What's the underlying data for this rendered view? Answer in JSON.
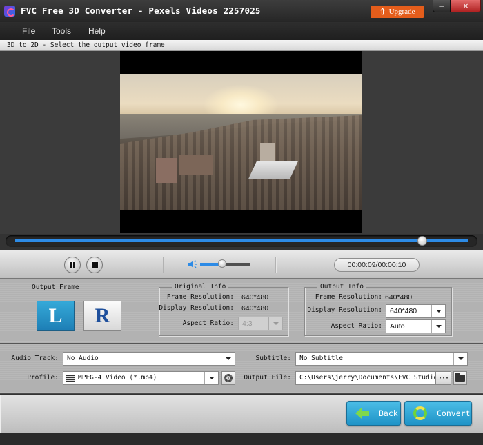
{
  "window": {
    "title": "FVC Free 3D Converter - Pexels Videos 2257025",
    "upgrade_label": "Upgrade",
    "minimize_glyph": "—",
    "close_glyph": "✕"
  },
  "menu": {
    "items": [
      {
        "label": "File"
      },
      {
        "label": "Tools"
      },
      {
        "label": "Help"
      }
    ]
  },
  "status": {
    "text": "3D to 2D - Select the output video frame"
  },
  "player": {
    "seek_progress": 0.9,
    "volume_level": 0.45,
    "time_display": "00:00:09/00:00:10",
    "accent_color": "#2d8be6"
  },
  "output_frame": {
    "heading": "Output Frame",
    "left_label": "L",
    "right_label": "R",
    "selected": "L"
  },
  "original_info": {
    "legend": "Original Info",
    "frame_resolution_label": "Frame Resolution:",
    "frame_resolution_value": "640*480",
    "display_resolution_label": "Display Resolution:",
    "display_resolution_value": "640*480",
    "aspect_ratio_label": "Aspect Ratio:",
    "aspect_ratio_value": "4:3"
  },
  "output_info": {
    "legend": "Output Info",
    "frame_resolution_label": "Frame Resolution:",
    "frame_resolution_value": "640*480",
    "display_resolution_label": "Display Resolution:",
    "display_resolution_value": "640*480",
    "aspect_ratio_label": "Aspect Ratio:",
    "aspect_ratio_value": "Auto"
  },
  "io": {
    "audio_track_label": "Audio Track:",
    "audio_track_value": "No Audio",
    "subtitle_label": "Subtitle:",
    "subtitle_value": "No Subtitle",
    "profile_label": "Profile:",
    "profile_value": "MPEG-4 Video (*.mp4)",
    "output_file_label": "Output File:",
    "output_file_value": "C:\\Users\\jerry\\Documents\\FVC Studio\\V",
    "browse_label": "···"
  },
  "footer": {
    "back_label": "Back",
    "convert_label": "Convert"
  }
}
